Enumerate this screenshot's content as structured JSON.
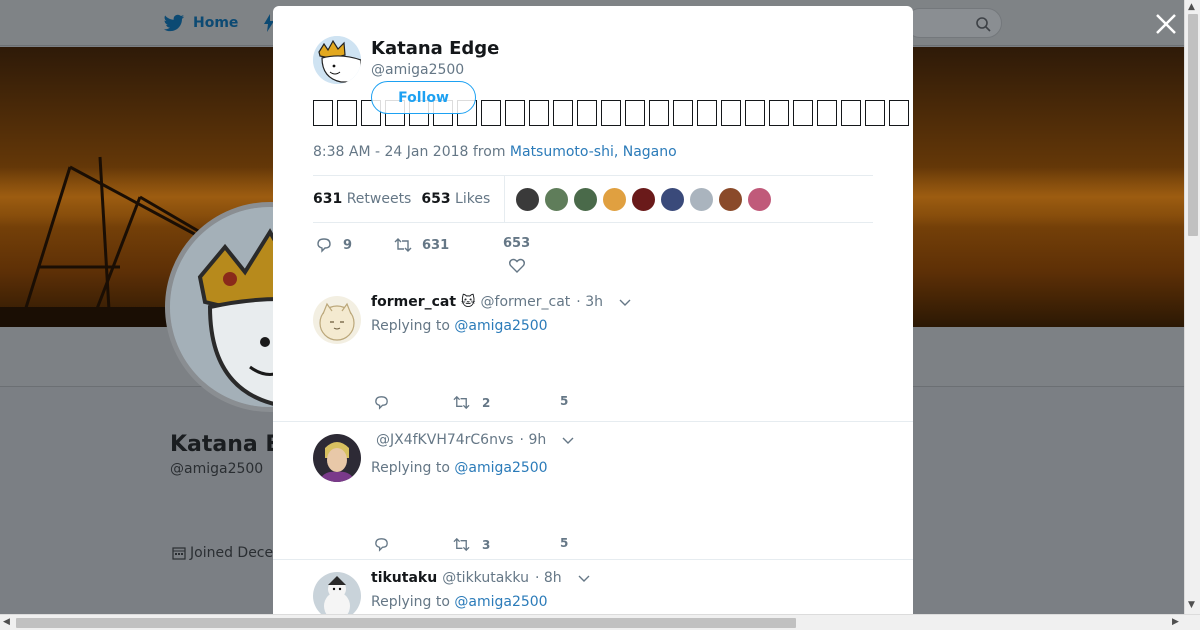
{
  "background": {
    "nav": {
      "home_label": "Home"
    },
    "profile": {
      "name": "Katana E",
      "handle": "@amiga2500",
      "joined": "Joined Dece"
    }
  },
  "tweet": {
    "author": {
      "name": "Katana Edge",
      "handle": "@amiga2500"
    },
    "follow_label": "Follow",
    "text_glyph_count": 36,
    "timestamp": "8:38 AM - 24 Jan 2018 from ",
    "location": "Matsumoto-shi, Nagano",
    "stats": {
      "retweets_count": "631",
      "retweets_label": "Retweets",
      "likes_count": "653",
      "likes_label": "Likes"
    },
    "likers": [
      "#3a3a3a",
      "#5f7d5a",
      "#4a6a4a",
      "#e0a040",
      "#6a1a1a",
      "#3a4a7a",
      "#aab4be",
      "#8a4a2a",
      "#c05a7a"
    ],
    "actions": {
      "replies": "9",
      "retweets": "631",
      "likes": "653"
    }
  },
  "replies": [
    {
      "name": "former_cat 🐱",
      "handle": "@former_cat",
      "time": "· 3h",
      "replying_prefix": "Replying to ",
      "replying_to": "@amiga2500",
      "actions": {
        "replies": "",
        "retweets": "2",
        "likes": "5"
      }
    },
    {
      "name": "",
      "handle": "@JX4fKVH74rC6nvs",
      "time": "· 9h",
      "replying_prefix": "Replying to ",
      "replying_to": "@amiga2500",
      "actions": {
        "replies": "",
        "retweets": "3",
        "likes": "5"
      }
    },
    {
      "name": "tikutaku",
      "handle": "@tikkutakku",
      "time": "· 8h",
      "replying_prefix": "Replying to ",
      "replying_to": "@amiga2500",
      "actions": {
        "replies": "",
        "retweets": "",
        "likes": ""
      }
    }
  ],
  "colors": {
    "accent": "#1da1f2",
    "link": "#2b7bb9",
    "muted": "#657786"
  }
}
